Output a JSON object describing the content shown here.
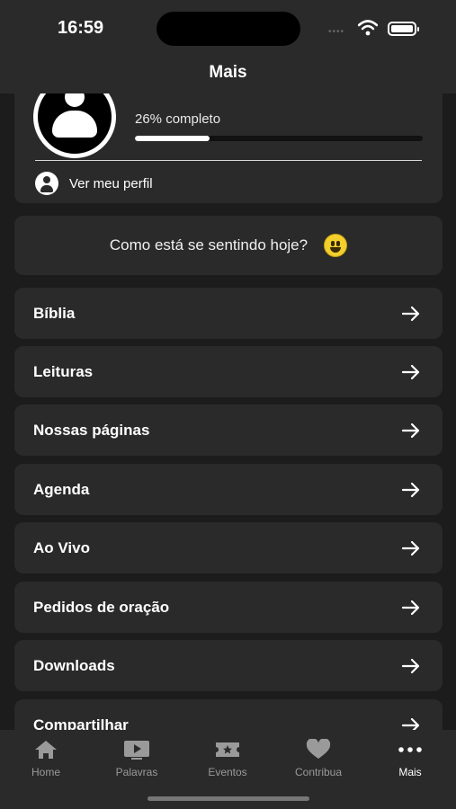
{
  "status_bar": {
    "time": "16:59"
  },
  "header": {
    "title": "Mais"
  },
  "profile": {
    "progress_label": "26% completo",
    "progress_percent": 26,
    "view_profile_label": "Ver meu perfil"
  },
  "mood": {
    "prompt": "Como está se sentindo hoje?"
  },
  "menu": {
    "items": [
      {
        "label": "Bíblia"
      },
      {
        "label": "Leituras"
      },
      {
        "label": "Nossas páginas"
      },
      {
        "label": "Agenda"
      },
      {
        "label": "Ao Vivo"
      },
      {
        "label": "Pedidos de oração"
      },
      {
        "label": "Downloads"
      },
      {
        "label": "Compartilhar"
      }
    ]
  },
  "tabbar": {
    "tabs": [
      {
        "label": "Home",
        "icon": "home-icon"
      },
      {
        "label": "Palavras",
        "icon": "video-icon"
      },
      {
        "label": "Eventos",
        "icon": "ticket-icon"
      },
      {
        "label": "Contribua",
        "icon": "heart-icon"
      },
      {
        "label": "Mais",
        "icon": "more-icon",
        "active": true
      }
    ]
  },
  "colors": {
    "background": "#1c1c1c",
    "card": "#2a2a2a",
    "inactive_tab": "#9a9a9a",
    "active_tab": "#ffffff"
  }
}
